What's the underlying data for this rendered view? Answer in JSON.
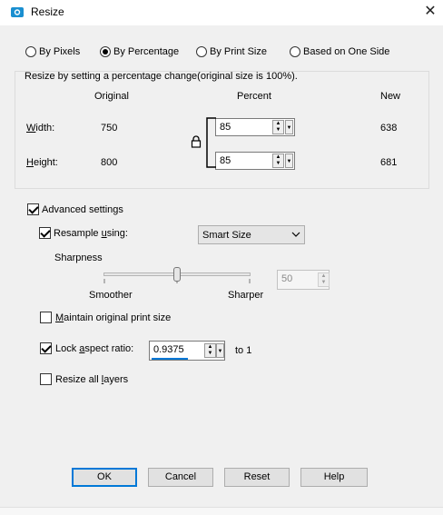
{
  "window": {
    "title": "Resize",
    "close_glyph": "✕"
  },
  "modes": [
    {
      "label": "By Pixels",
      "selected": false
    },
    {
      "label": "By Percentage",
      "selected": true
    },
    {
      "label": "By Print Size",
      "selected": false
    },
    {
      "label": "Based on One Side",
      "selected": false
    }
  ],
  "group": {
    "caption": "Resize by setting a percentage change(original size is 100%).",
    "col_original": "Original",
    "col_percent": "Percent",
    "col_new": "New",
    "width": {
      "label_u": "W",
      "label_rest": "idth:",
      "original": "750",
      "percent": "85",
      "new": "638"
    },
    "height": {
      "label_u": "H",
      "label_rest": "eight:",
      "original": "800",
      "percent": "85",
      "new": "681"
    }
  },
  "advanced": {
    "label": "Advanced settings",
    "checked": true
  },
  "resample": {
    "label_pre": "Resample ",
    "label_u": "u",
    "label_post": "sing:",
    "checked": true,
    "selected": "Smart Size"
  },
  "sharpness": {
    "label": "Sharpness",
    "left": "Smoother",
    "right": "Sharper",
    "value": "50",
    "level": 0.5
  },
  "maintain": {
    "label_u": "M",
    "label_rest": "aintain original print size",
    "checked": false
  },
  "lock_aspect": {
    "label_pre": "Lock ",
    "label_u": "a",
    "label_post": "spect ratio:",
    "checked": true,
    "value": "0.9375",
    "suffix": "to 1"
  },
  "resize_layers": {
    "label_pre": "Resize all ",
    "label_u": "l",
    "label_post": "ayers",
    "checked": false
  },
  "buttons": {
    "ok": "OK",
    "cancel": "Cancel",
    "reset": "Reset",
    "help": "Help"
  },
  "icons": {
    "app": "camera-icon",
    "lock": "lock-icon"
  },
  "colors": {
    "accent": "#0078d7",
    "app_icon": "#1a8fd0"
  }
}
